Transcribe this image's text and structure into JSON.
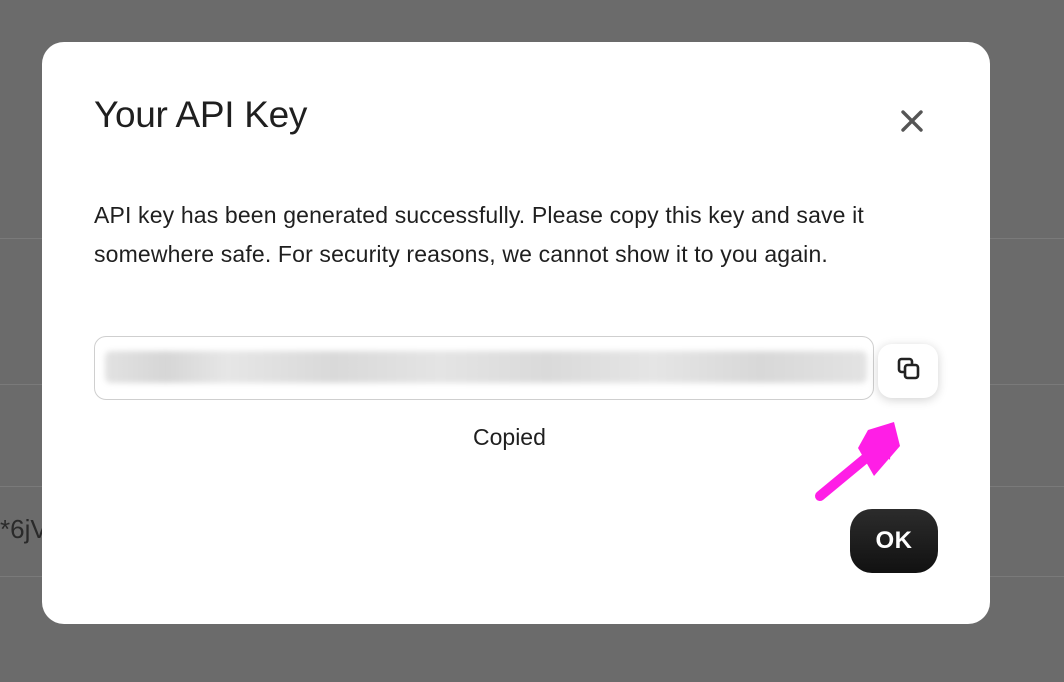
{
  "background": {
    "partial_text": "*6jV"
  },
  "modal": {
    "title": "Your API Key",
    "message": "API key has been generated successfully. Please copy this key and save it somewhere safe. For security reasons, we cannot show it to you again.",
    "api_key_value": "",
    "copied_label": "Copied",
    "ok_label": "OK"
  },
  "icons": {
    "close": "close-icon",
    "copy": "copy-icon",
    "annotation": "arrow-annotation"
  },
  "colors": {
    "backdrop": "#6b6b6b",
    "modal_bg": "#ffffff",
    "ok_button": "#1a1a1a",
    "annotation_arrow": "#ff1ee6"
  }
}
